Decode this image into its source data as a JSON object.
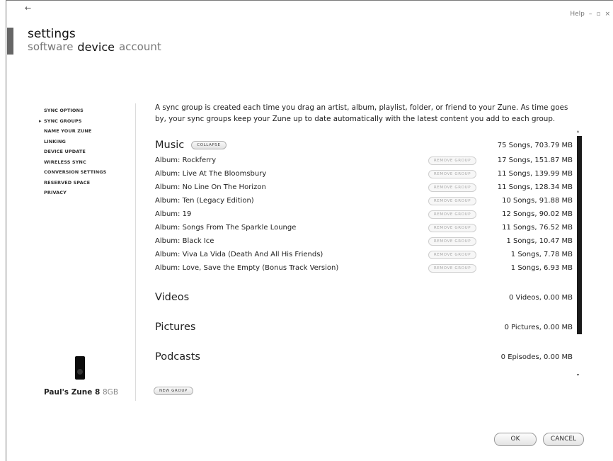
{
  "window": {
    "help": "Help",
    "minimize": "–",
    "restore": "▫",
    "close": "×"
  },
  "header": {
    "title": "settings",
    "tabs": [
      {
        "label": "software",
        "active": false
      },
      {
        "label": "device",
        "active": true
      },
      {
        "label": "account",
        "active": false
      }
    ]
  },
  "sidebar": {
    "items": [
      {
        "label": "SYNC OPTIONS"
      },
      {
        "label": "SYNC GROUPS",
        "selected": true
      },
      {
        "label": "NAME YOUR ZUNE"
      },
      {
        "label": "LINKING"
      },
      {
        "label": "DEVICE UPDATE"
      },
      {
        "label": "WIRELESS SYNC"
      },
      {
        "label": "CONVERSION SETTINGS"
      },
      {
        "label": "RESERVED SPACE"
      },
      {
        "label": "PRIVACY"
      }
    ],
    "device_name": "Paul's Zune 8",
    "device_capacity": "8GB"
  },
  "main": {
    "intro": "A sync group is created each time you drag an artist, album, playlist, folder, or friend to your Zune. As time goes by, your sync groups keep your Zune up to date automatically with the latest content you add to each group.",
    "music": {
      "title": "Music",
      "collapse_label": "COLLAPSE",
      "summary": "75 Songs, 703.79 MB",
      "remove_label": "REMOVE GROUP",
      "albums": [
        {
          "name": "Album: Rockferry",
          "size": "17 Songs, 151.87 MB"
        },
        {
          "name": "Album: Live At The Bloomsbury",
          "size": "11 Songs, 139.99 MB"
        },
        {
          "name": "Album: No Line On The Horizon",
          "size": "11 Songs, 128.34 MB"
        },
        {
          "name": "Album: Ten (Legacy Edition)",
          "size": "10 Songs, 91.88 MB"
        },
        {
          "name": "Album: 19",
          "size": "12 Songs, 90.02 MB"
        },
        {
          "name": "Album: Songs From The Sparkle Lounge",
          "size": "11 Songs, 76.52 MB"
        },
        {
          "name": "Album: Black Ice",
          "size": "1 Songs, 10.47 MB"
        },
        {
          "name": "Album: Viva La Vida (Death And All His Friends)",
          "size": "1 Songs, 7.78 MB"
        },
        {
          "name": "Album: Love, Save the Empty (Bonus Track Version)",
          "size": "1 Songs, 6.93 MB"
        }
      ]
    },
    "videos": {
      "title": "Videos",
      "summary": "0 Videos, 0.00 MB"
    },
    "pictures": {
      "title": "Pictures",
      "summary": "0 Pictures, 0.00 MB"
    },
    "podcasts": {
      "title": "Podcasts",
      "summary": "0 Episodes, 0.00 MB"
    },
    "new_group_label": "NEW GROUP"
  },
  "footer": {
    "ok": "OK",
    "cancel": "CANCEL"
  }
}
